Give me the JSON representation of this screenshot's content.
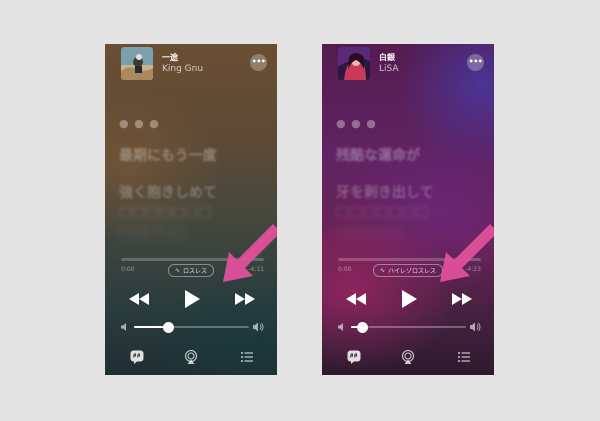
{
  "left_player": {
    "song_title": "一途",
    "artist": "King Gnu",
    "lyrics": [
      "最期にもう一度",
      "強く抱きしめて",
      "□□□□□□□",
      "□□□□□"
    ],
    "elapsed": "0:00",
    "remaining": "-4:11",
    "quality_badge": "ロスレス",
    "volume_level": 0.3,
    "progress": 0.0,
    "bg_color": "#5c4a36"
  },
  "right_player": {
    "song_title": "白銀",
    "artist": "LiSA",
    "lyrics": [
      "残酷な運命が",
      "牙を剥き出して",
      "□□□□□□□",
      "□□□□□"
    ],
    "elapsed": "0:00",
    "remaining": "-4:23",
    "quality_badge": "ハイレゾロスレス",
    "volume_level": 0.1,
    "progress": 0.0,
    "bg_color": "#612364"
  },
  "common": {
    "more_label": "•••",
    "dots_label": "● ● ●",
    "accent_arrow_color": "#e0509a",
    "icons": {
      "more": "ellipsis-icon",
      "prev": "rewind-icon",
      "play": "play-icon",
      "next": "fast-forward-icon",
      "vol_low": "speaker-low-icon",
      "vol_high": "speaker-high-icon",
      "lyrics": "lyrics-icon",
      "airplay": "airplay-icon",
      "queue": "queue-list-icon",
      "lossless": "waveform-icon"
    }
  }
}
